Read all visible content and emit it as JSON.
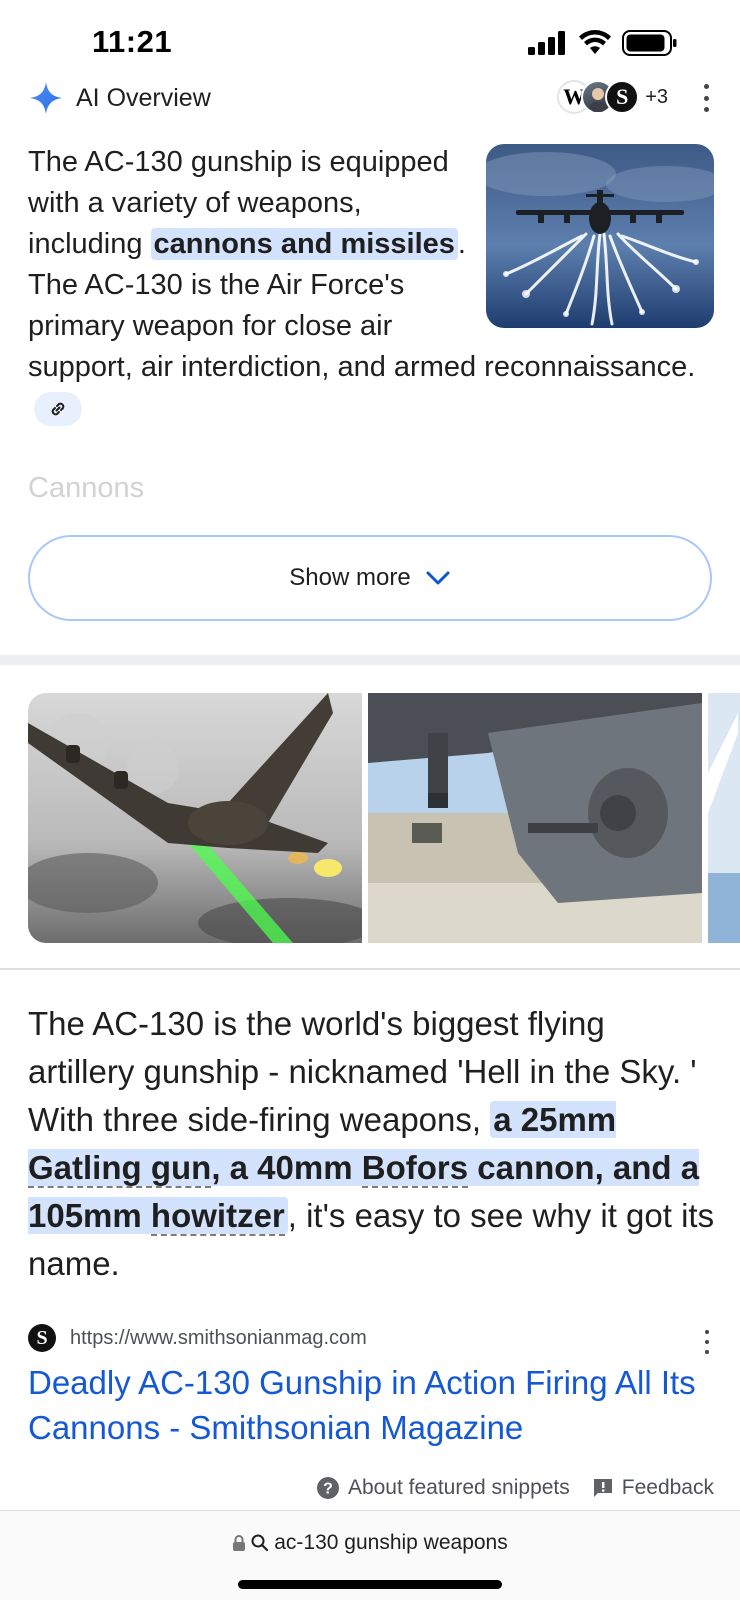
{
  "status_bar": {
    "time": "11:21",
    "icons": [
      "cellular-signal-icon",
      "wifi-icon",
      "battery-icon"
    ]
  },
  "ai_overview": {
    "title": "AI Overview",
    "icon": "ai-sparkle-icon",
    "sources": {
      "avatars": [
        {
          "name": "wikipedia-icon",
          "letter": "W"
        },
        {
          "name": "person-avatar-icon",
          "letter": ""
        },
        {
          "name": "smithsonian-icon",
          "letter": "S"
        }
      ],
      "more_count": "+3"
    },
    "text": {
      "part1": "The AC-130 gunship is equipped with a variety of weapons, including ",
      "highlight": "cannons and missiles",
      "part2": ". The AC-130 is the Air Force's primary weapon for close air support, air interdiction, and armed re­connaissance."
    },
    "faded_heading": "Cannons",
    "show_more_label": "Show more"
  },
  "snippet": {
    "text_before": "The AC-130 is the world's biggest flying artillery gunship - nicknamed 'Hell in the Sky. ' With three side-firing weapons, ",
    "hl_a": "a 25mm ",
    "hl_gatling": "Gatling gun",
    "hl_b": ", a 40mm ",
    "hl_bofors": "Bofors",
    "hl_c": " cannon, and a 105mm ",
    "hl_howitzer": "howitzer",
    "text_after": ", it's easy to see why it got its name.",
    "source_letter": "S",
    "source_url": "https://www.smithsonianmag.com",
    "result_title": "Deadly AC-130 Gunship in Action Firing All Its Cannons - Smithsonian Magazine"
  },
  "footer": {
    "about_label": "About featured snippets",
    "feedback_label": "Feedback"
  },
  "url_bar": {
    "query": "ac-130 gunship weapons"
  },
  "colors": {
    "highlight": "#d3e3fd",
    "link": "#1558d6",
    "accent_blue": "#4285f4"
  }
}
